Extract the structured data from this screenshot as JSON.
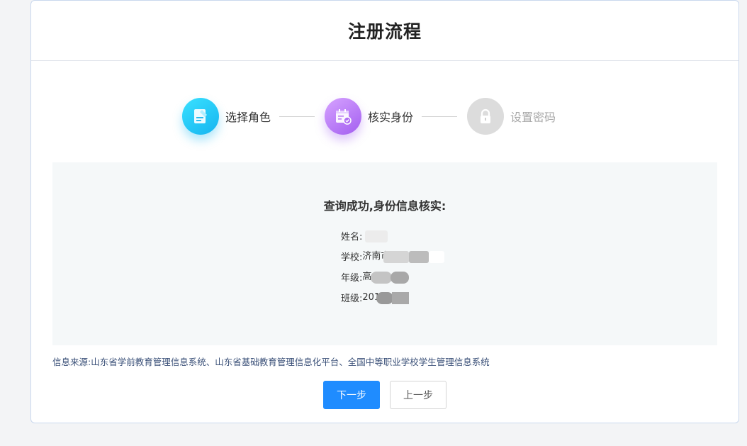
{
  "header": {
    "title": "注册流程"
  },
  "steps": [
    {
      "label": "选择角色",
      "icon": "edit-document-icon",
      "status": "done",
      "color": "#1cbef4"
    },
    {
      "label": "核实身份",
      "icon": "calendar-check-icon",
      "status": "active",
      "color": "#b06ef3"
    },
    {
      "label": "设置密码",
      "icon": "lock-icon",
      "status": "pending",
      "color": "#dcdcdc"
    }
  ],
  "verification": {
    "title": "查询成功,身份信息核实:",
    "fields": [
      {
        "label": "姓名:",
        "value": ""
      },
      {
        "label": "学校:",
        "value": "济南市"
      },
      {
        "label": "年级:",
        "value": "高"
      },
      {
        "label": "班级:",
        "value": "201"
      }
    ]
  },
  "source_text": "信息来源:山东省学前教育管理信息系统、山东省基础教育管理信息化平台、全国中等职业学校学生管理信息系统",
  "buttons": {
    "next": "下一步",
    "prev": "上一步"
  },
  "colors": {
    "primary": "#1f8cff",
    "panel_bg": "#f5f8f9",
    "source_text": "#3a5078"
  }
}
